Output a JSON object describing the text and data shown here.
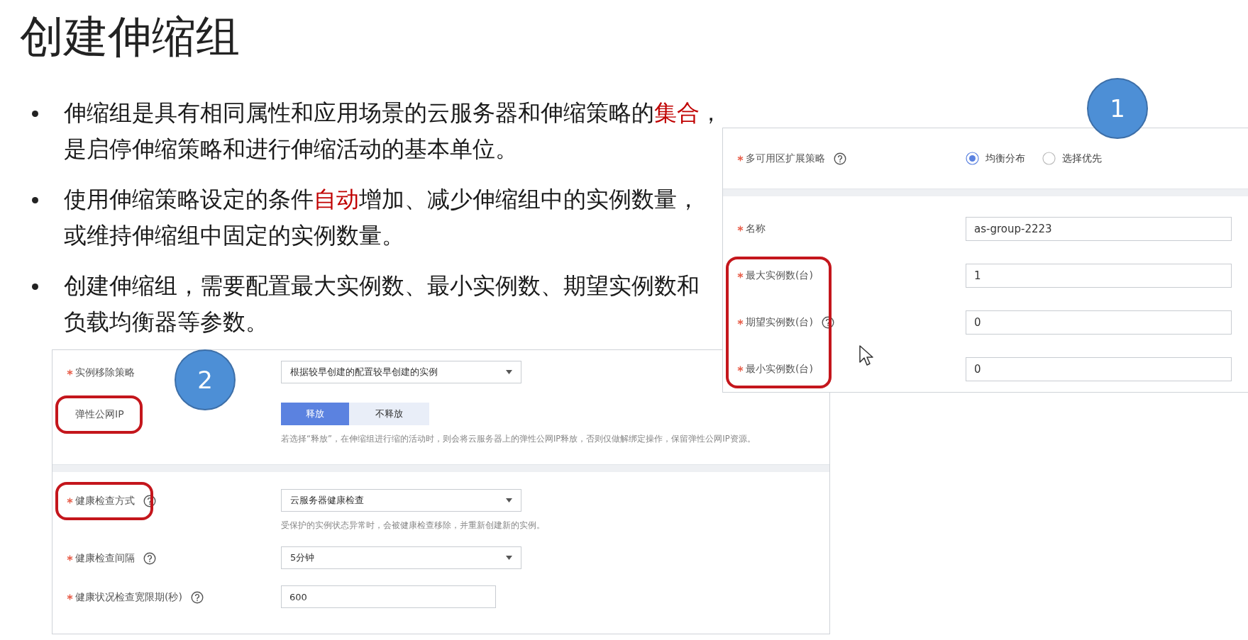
{
  "title": "创建伸缩组",
  "bullets": [
    {
      "lines": [
        {
          "segments": [
            {
              "text": "伸缩组是具有相同属性和应用场景的云服务器和伸缩策略的",
              "emphasis": false
            },
            {
              "text": "集合",
              "emphasis": true
            },
            {
              "text": "，",
              "emphasis": false
            }
          ]
        },
        {
          "segments": [
            {
              "text": "是启停伸缩策略和进行伸缩活动的基本单位。",
              "emphasis": false
            }
          ]
        }
      ]
    },
    {
      "lines": [
        {
          "segments": [
            {
              "text": "使用伸缩策略设定的条件",
              "emphasis": false
            },
            {
              "text": "自动",
              "emphasis": true
            },
            {
              "text": "增加、减少伸缩组中的实例数量，",
              "emphasis": false
            }
          ]
        },
        {
          "segments": [
            {
              "text": "或维持伸缩组中固定的实例数量。",
              "emphasis": false
            }
          ]
        }
      ]
    },
    {
      "lines": [
        {
          "segments": [
            {
              "text": "创建伸缩组，需要配置最大实例数、最小实例数、期望实例数和",
              "emphasis": false
            }
          ]
        },
        {
          "segments": [
            {
              "text": "负载均衡器等参数。",
              "emphasis": false
            }
          ]
        }
      ]
    }
  ],
  "panels": [
    {
      "callout": "1",
      "sections": [
        [
          {
            "kind": "radio",
            "label": "多可用区扩展策略",
            "required": true,
            "help": true,
            "highlighted": false,
            "options": [
              {
                "label": "均衡分布",
                "selected": true
              },
              {
                "label": "选择优先",
                "selected": false
              }
            ]
          }
        ],
        [
          {
            "kind": "input",
            "label": "名称",
            "required": true,
            "help": false,
            "highlighted": false,
            "value": "as-group-2223"
          },
          {
            "kind": "input",
            "label": "最大实例数(台)",
            "required": true,
            "help": false,
            "highlighted": true,
            "value": "1"
          },
          {
            "kind": "input",
            "label": "期望实例数(台)",
            "required": true,
            "help": true,
            "highlighted": true,
            "value": "0"
          },
          {
            "kind": "input",
            "label": "最小实例数(台)",
            "required": true,
            "help": false,
            "highlighted": true,
            "value": "0"
          }
        ]
      ]
    },
    {
      "callout": "2",
      "sections": [
        [
          {
            "kind": "select",
            "label": "实例移除策略",
            "required": true,
            "help": false,
            "highlighted": false,
            "value": "根据较早创建的配置较早创建的实例"
          },
          {
            "kind": "segmented",
            "label": "弹性公网IP",
            "required": false,
            "help": false,
            "highlighted": true,
            "options": [
              {
                "label": "释放",
                "selected": true
              },
              {
                "label": "不释放",
                "selected": false
              }
            ],
            "hint": "若选择“释放”，在伸缩组进行缩的活动时，则会将云服务器上的弹性公网IP释放，否则仅做解绑定操作，保留弹性公网IP资源。"
          }
        ],
        [
          {
            "kind": "select",
            "label": "健康检查方式",
            "required": true,
            "help": true,
            "highlighted": true,
            "value": "云服务器健康检查",
            "hint": "受保护的实例状态异常时，会被健康检查移除，并重新创建新的实例。"
          },
          {
            "kind": "select",
            "label": "健康检查间隔",
            "required": true,
            "help": true,
            "highlighted": false,
            "value": "5分钟"
          },
          {
            "kind": "input",
            "label": "健康状况检查宽限期(秒)",
            "required": true,
            "help": true,
            "highlighted": false,
            "value": "600"
          }
        ]
      ]
    }
  ]
}
